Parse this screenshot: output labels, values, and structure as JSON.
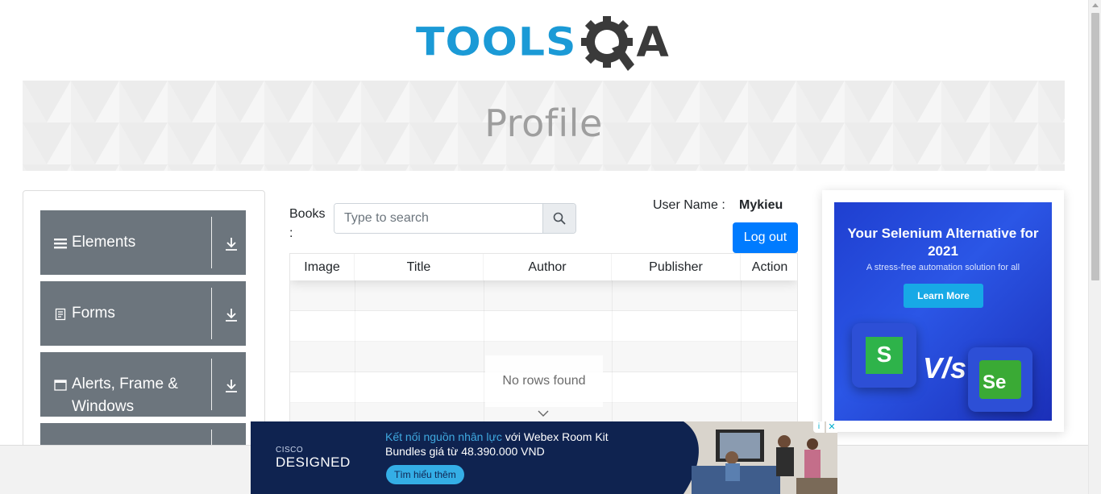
{
  "header": {
    "logo_main": "TOOLS",
    "logo_tail": "A"
  },
  "banner": {
    "title": "Profile"
  },
  "sidebar": {
    "groups": [
      {
        "label": "Elements",
        "icon": "menu-icon"
      },
      {
        "label": "Forms",
        "icon": "document-icon"
      },
      {
        "label": "Alerts, Frame & Windows",
        "icon": "window-icon"
      },
      {
        "label": "",
        "icon": "widgets-icon"
      }
    ]
  },
  "books": {
    "label": "Books :",
    "search_placeholder": "Type to search"
  },
  "user": {
    "label": "User Name :",
    "value": "Mykieu",
    "logout_label": "Log out"
  },
  "table": {
    "columns": [
      "Image",
      "Title",
      "Author",
      "Publisher",
      "Action"
    ],
    "empty_message": "No rows found"
  },
  "right_ad": {
    "title": "Your Selenium Alternative for 2021",
    "subtitle": "A stress-free automation solution for all",
    "button": "Learn More",
    "vs": "V/s",
    "left_tile": "S",
    "right_tile": "Se"
  },
  "bottom_ad": {
    "brand_small": "CISCO",
    "brand": "DESIGNED",
    "line1_highlight": "Kết nối nguồn nhân lực",
    "line1_rest": " với Webex Room Kit",
    "line2": "Bundles giá từ 48.390.000 VND",
    "cta": "Tìm hiểu thêm",
    "close": "✕",
    "info": "i"
  },
  "colors": {
    "nav_bg": "#6c757d",
    "primary": "#007bff",
    "logo_blue": "#1b9ad6",
    "ad_blue": "#1f3fd0"
  }
}
